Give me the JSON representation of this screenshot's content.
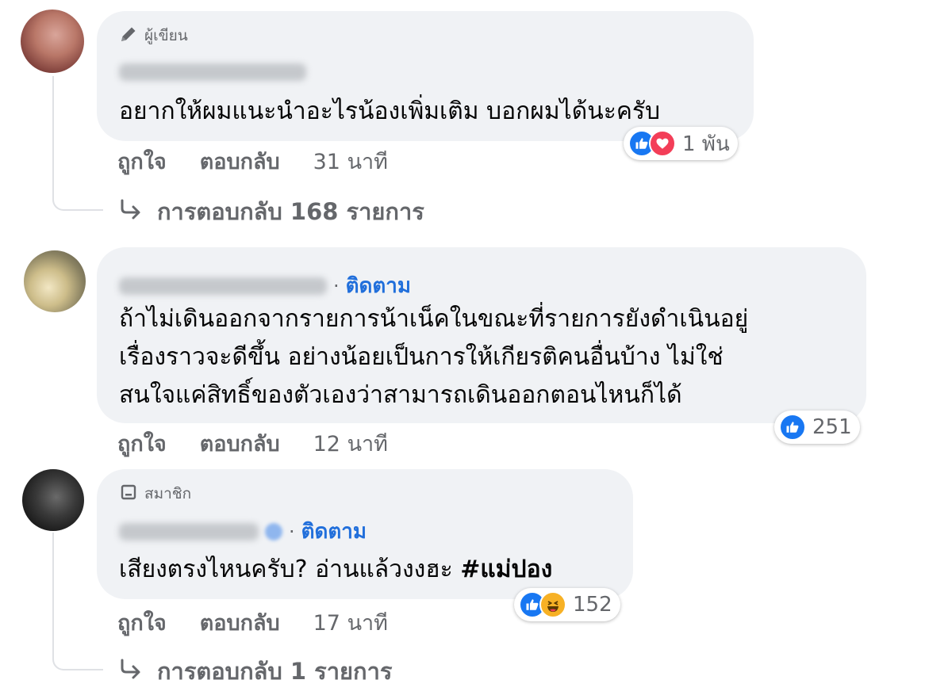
{
  "comments": [
    {
      "badge": {
        "label": "ผู้เขียน"
      },
      "text_lines": [
        "อยากให้ผมแนะนำอะไรน้องเพิ่มเติม บอกผมได้นะครับ"
      ],
      "actions": {
        "like": "ถูกใจ",
        "reply": "ตอบกลับ",
        "time": "31 นาที"
      },
      "reaction_count": "1 พัน",
      "replies_label": "การตอบกลับ 168 รายการ"
    },
    {
      "follow": "ติดตาม",
      "text_lines": [
        "ถ้าไม่เดินออกจากรายการน้าเน็คในขณะที่รายการยังดำเนินอยู่",
        "เรื่องราวจะดีขึ้น อย่างน้อยเป็นการให้เกียรติคนอื่นบ้าง ไม่ใช่",
        "สนใจแค่สิทธิ์ของตัวเองว่าสามารถเดินออกตอนไหนก็ได้"
      ],
      "actions": {
        "like": "ถูกใจ",
        "reply": "ตอบกลับ",
        "time": "12 นาที"
      },
      "reaction_count": "251"
    },
    {
      "badge": {
        "label": "สมาชิก"
      },
      "follow": "ติดตาม",
      "text": "เสียงตรงไหนครับ? อ่านแล้วงงฮะ ",
      "hashtag": "#แม่ปอง",
      "actions": {
        "like": "ถูกใจ",
        "reply": "ตอบกลับ",
        "time": "17 นาที"
      },
      "reaction_count": "152",
      "replies_label": "การตอบกลับ 1 รายการ"
    }
  ],
  "colors": {
    "bubble": "#f0f2f5",
    "link_blue": "#216fdb",
    "muted": "#65676b",
    "like_blue": "#1877f2",
    "love_red": "#f33e58",
    "haha_yellow": "#f7b125"
  },
  "icons": [
    "pencil-icon",
    "member-badge-icon",
    "like-reaction-icon",
    "love-reaction-icon",
    "haha-reaction-icon",
    "reply-arrow-icon"
  ]
}
